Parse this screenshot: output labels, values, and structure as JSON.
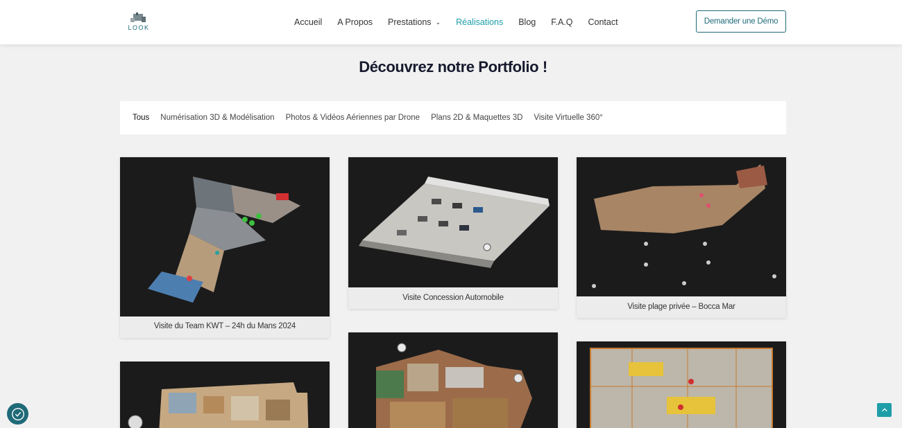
{
  "header": {
    "logo_text": "LOOK",
    "nav": [
      {
        "label": "Accueil"
      },
      {
        "label": "A Propos"
      },
      {
        "label": "Prestations"
      },
      {
        "label": "Réalisations"
      },
      {
        "label": "Blog"
      },
      {
        "label": "F.A.Q"
      },
      {
        "label": "Contact"
      }
    ],
    "demo_button": "Demander une Démo"
  },
  "page_title": "Découvrez notre Portfolio !",
  "filters": [
    {
      "label": "Tous"
    },
    {
      "label": "Numérisation 3D & Modélisation"
    },
    {
      "label": "Photos & Vidéos Aériennes par Drone"
    },
    {
      "label": "Plans 2D & Maquettes 3D"
    },
    {
      "label": "Visite Virtuelle 360°"
    }
  ],
  "portfolio": [
    {
      "caption": "Visite du Team KWT – 24h du Mans 2024"
    },
    {
      "caption": "Visite Concession Automobile"
    },
    {
      "caption": "Visite plage privée – Bocca Mar"
    },
    {
      "caption": ""
    },
    {
      "caption": ""
    },
    {
      "caption": ""
    }
  ],
  "colors": {
    "accent": "#1c9ea8",
    "brand_dark": "#1f6a78",
    "background": "#f1f1f1"
  },
  "icons": {
    "cookie": "cookie-settings-icon",
    "scroll_top": "arrow-up-icon",
    "dropdown": "chevron-down-icon"
  }
}
